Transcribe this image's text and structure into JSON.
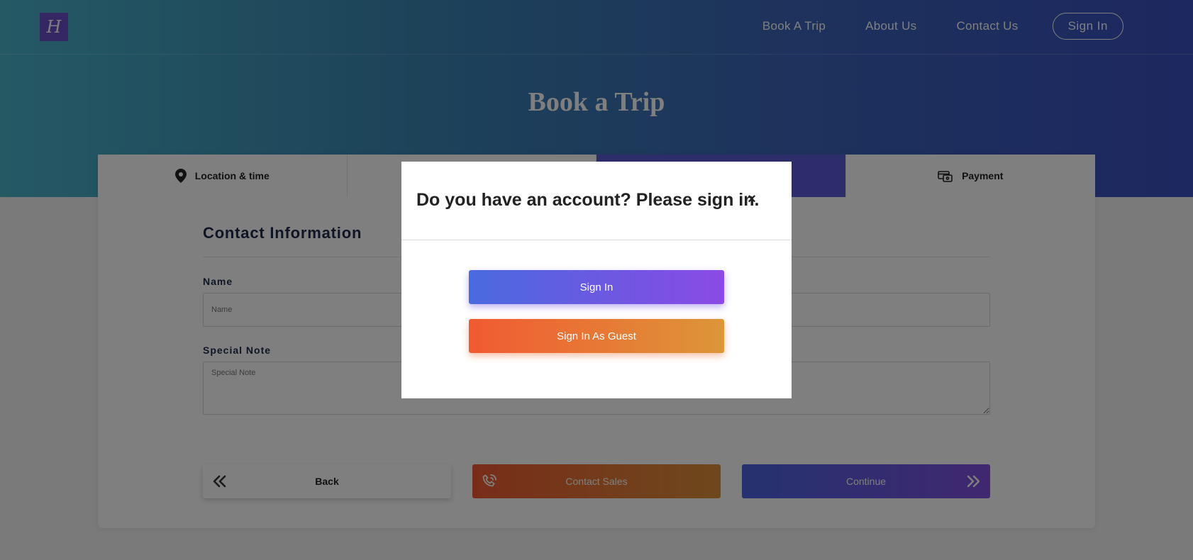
{
  "brand": {
    "logo_glyph": "H"
  },
  "nav": {
    "links": [
      "Book A Trip",
      "About Us",
      "Contact Us"
    ],
    "sign_in": "Sign In"
  },
  "page": {
    "title": "Book a Trip"
  },
  "steps": [
    {
      "label": "Location & time",
      "icon": "map-pin-icon",
      "active": false
    },
    {
      "label": "",
      "icon": "",
      "active": false
    },
    {
      "label": "",
      "icon": "",
      "active": true
    },
    {
      "label": "Payment",
      "icon": "payment-icon",
      "active": false
    }
  ],
  "form": {
    "section_title": "Contact Information",
    "name": {
      "label": "Name",
      "placeholder": "Name",
      "value": ""
    },
    "note": {
      "label": "Special Note",
      "placeholder": "Special Note",
      "value": ""
    }
  },
  "actions": {
    "back": "Back",
    "contact_sales": "Contact Sales",
    "continue": "Continue"
  },
  "modal": {
    "title": "Do you have an account? Please sign in.",
    "close": "×",
    "sign_in": "Sign In",
    "sign_in_guest": "Sign In As Guest"
  },
  "colors": {
    "accent_purple": "#5b5bd6",
    "gradient_blue_start": "#4a6ae0",
    "gradient_purple_end": "#8a4ae4",
    "gradient_orange_start": "#f15a32",
    "gradient_orange_end": "#dd9638"
  }
}
